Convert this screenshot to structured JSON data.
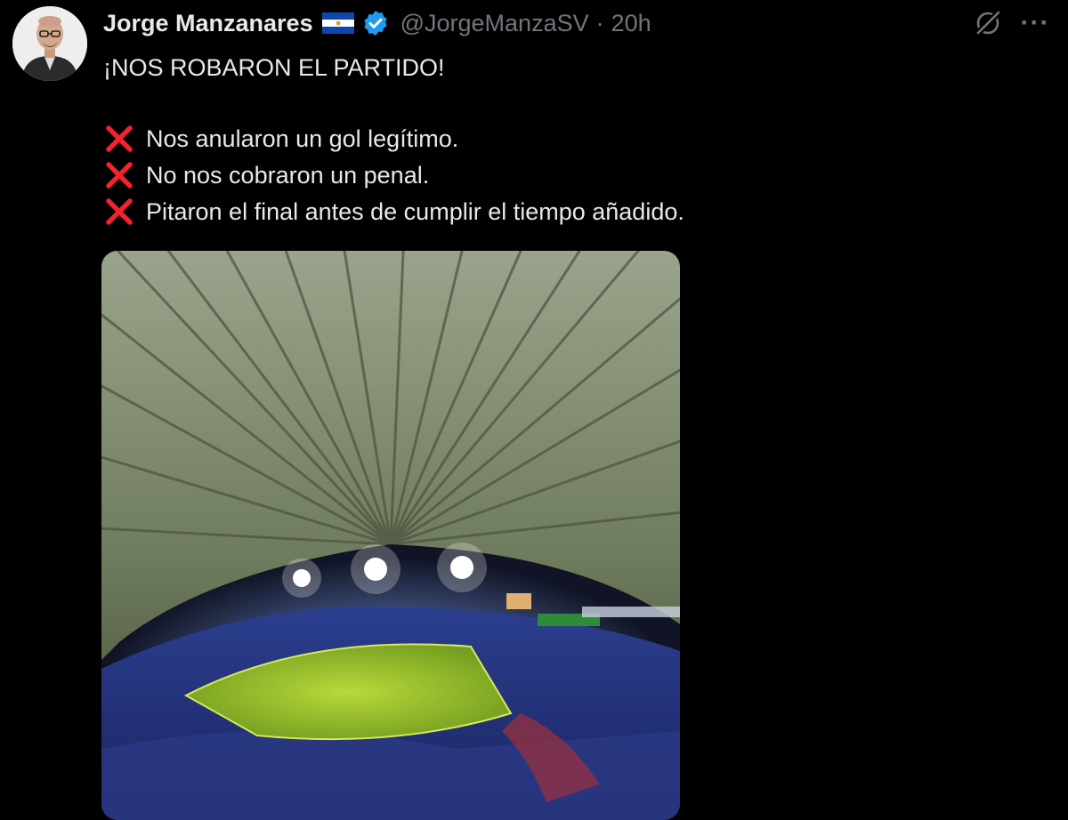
{
  "tweet": {
    "author": {
      "name": "Jorge Manzanares",
      "handle": "@JorgeManzaSV",
      "verified": true,
      "flag": "El Salvador flag",
      "avatar_icon": "avatar-photo"
    },
    "separator": "·",
    "time": "20h",
    "headline": "¡NOS ROBARON EL PARTIDO!",
    "bullets": [
      "Nos anularon un gol legítimo.",
      "No nos cobraron un penal.",
      "Pitaron el final antes de cumplir el tiempo añadido."
    ],
    "bullet_icon": "cross-mark-icon",
    "media": {
      "description_icon": "stadium-photo"
    }
  },
  "actions": {
    "grok_icon": "grok-icon",
    "more": "···"
  },
  "colors": {
    "background": "#000000",
    "text": "#e7e9ea",
    "muted": "#71767b",
    "verified": "#1d9bf0",
    "cross": "#f4212e"
  }
}
